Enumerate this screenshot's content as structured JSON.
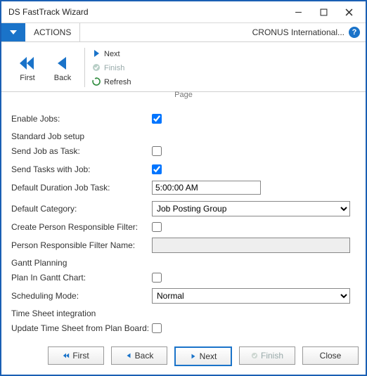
{
  "window": {
    "title": "DS FastTrack Wizard"
  },
  "tabs": {
    "actions": "ACTIONS"
  },
  "company": "CRONUS International...",
  "ribbon": {
    "first": "First",
    "back": "Back",
    "next": "Next",
    "finish": "Finish",
    "refresh": "Refresh",
    "group": "Page"
  },
  "form": {
    "enable_jobs": {
      "label": "Enable Jobs:",
      "checked": true
    },
    "section_std": "Standard Job setup",
    "send_job_task": {
      "label": "Send Job as Task:",
      "checked": false
    },
    "send_tasks_job": {
      "label": "Send Tasks with Job:",
      "checked": true
    },
    "default_duration": {
      "label": "Default Duration Job Task:",
      "value": "5:00:00 AM"
    },
    "default_category": {
      "label": "Default Category:",
      "value": "Job Posting Group"
    },
    "create_filter": {
      "label": "Create Person Responsible Filter:",
      "checked": false
    },
    "filter_name": {
      "label": "Person Responsible Filter Name:",
      "value": ""
    },
    "section_gantt": "Gantt Planning",
    "plan_gantt": {
      "label": "Plan In Gantt Chart:",
      "checked": false
    },
    "scheduling_mode": {
      "label": "Scheduling Mode:",
      "value": "Normal"
    },
    "section_ts": "Time Sheet integration",
    "update_ts": {
      "label": "Update Time Sheet from Plan Board:",
      "checked": false
    }
  },
  "footer": {
    "first": "First",
    "back": "Back",
    "next": "Next",
    "finish": "Finish",
    "close": "Close"
  }
}
